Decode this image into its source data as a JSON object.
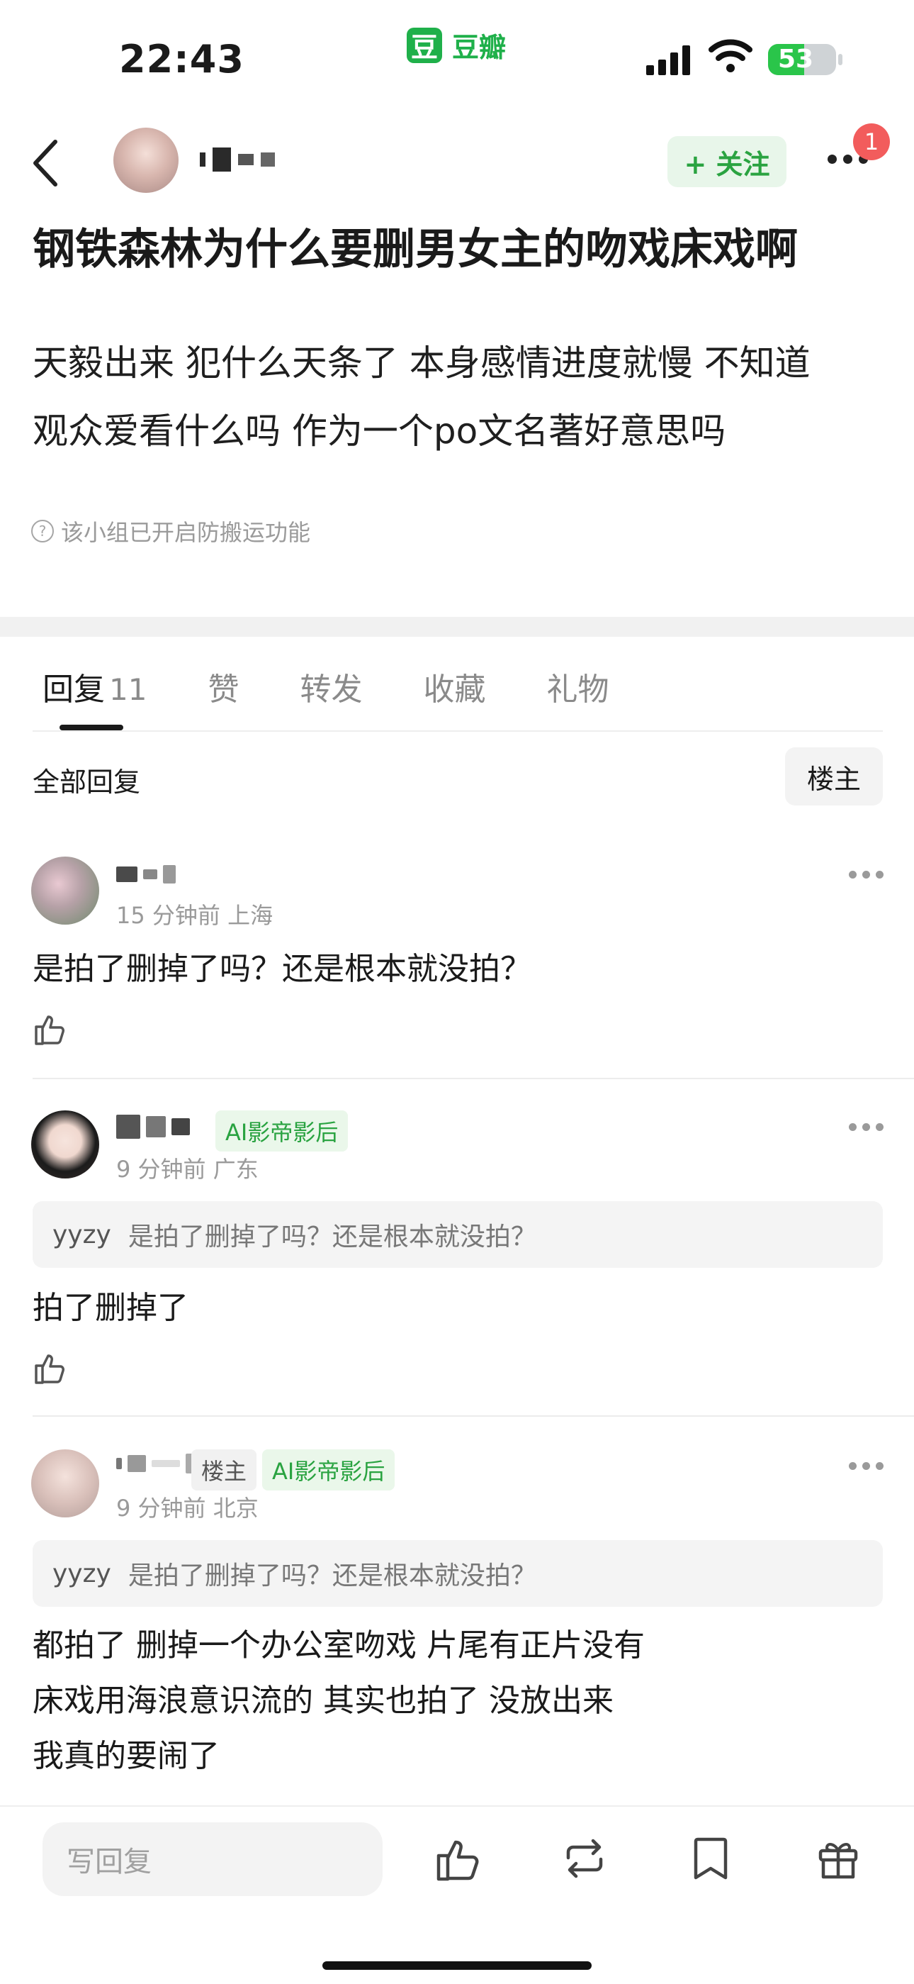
{
  "status_bar": {
    "time": "22:43",
    "app_name": "豆瓣",
    "app_logo": "豆",
    "battery": "53",
    "battery_level": 0.53
  },
  "nav": {
    "follow_label": "+ 关注",
    "notification_count": "1"
  },
  "post": {
    "title": "钢铁森林为什么要删男女主的吻戏床戏啊",
    "body_lines": [
      "天毅出来 犯什么天条了 本身感情进度就慢  不知道",
      "观众爱看什么吗  作为一个po文名著好意思吗"
    ],
    "notice": "该小组已开启防搬运功能"
  },
  "tabs": [
    {
      "label": "回复",
      "count": "11"
    },
    {
      "label": "赞"
    },
    {
      "label": "转发"
    },
    {
      "label": "收藏"
    },
    {
      "label": "礼物"
    }
  ],
  "replies_header": {
    "label": "全部回复",
    "op_filter": "楼主"
  },
  "comments": [
    {
      "meta": "15 分钟前 上海",
      "text_lines": [
        "是拍了删掉了吗？还是根本就没拍？"
      ]
    },
    {
      "badge": "AI影帝影后",
      "meta": "9 分钟前 广东",
      "quote_name": "yyzy",
      "quote_text": "是拍了删掉了吗？还是根本就没拍？",
      "text_lines": [
        "拍了删掉了"
      ]
    },
    {
      "op_badge": "楼主",
      "badge": "AI影帝影后",
      "meta": "9 分钟前 北京",
      "quote_name": "yyzy",
      "quote_text": "是拍了删掉了吗？还是根本就没拍？",
      "text_lines": [
        "都拍了  删掉一个办公室吻戏 片尾有正片没有",
        "床戏用海浪意识流的  其实也拍了 没放出来",
        "我真的要闹了"
      ]
    }
  ],
  "bottom_bar": {
    "reply_placeholder": "写回复"
  },
  "colors": {
    "brand_green": "#2aa341",
    "notification_red": "#f25c5c"
  }
}
